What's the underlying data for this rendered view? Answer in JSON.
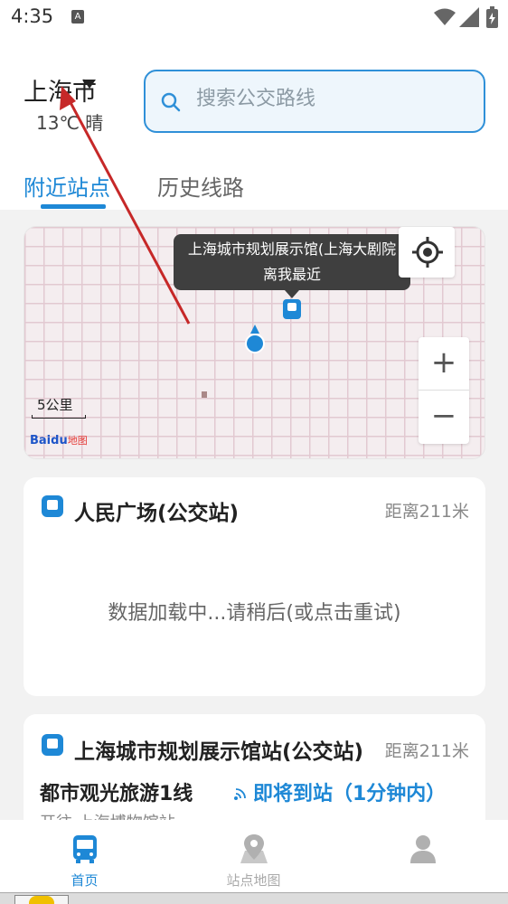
{
  "status_bar": {
    "time": "4:35",
    "notification_badge": "A"
  },
  "header": {
    "city": "上海市",
    "weather": "13℃ 晴",
    "search": {
      "placeholder": "搜索公交路线"
    }
  },
  "tabs": [
    {
      "label": "附近站点",
      "active": true
    },
    {
      "label": "历史线路",
      "active": false
    }
  ],
  "map": {
    "tooltip_line1": "上海城市规划展示馆(上海大剧院",
    "tooltip_line2": "离我最近",
    "scale": "5公里",
    "logo_bai": "Bai",
    "logo_du": "du",
    "logo_suffix": "地图",
    "zoom_in": "+",
    "zoom_out": "−"
  },
  "stops": [
    {
      "name": "人民广场(公交站)",
      "distance": "距离211米",
      "status": "数据加载中...请稍后(或点击重试)"
    },
    {
      "name": "上海城市规划展示馆站(公交站)",
      "distance": "距离211米",
      "route": "都市观光旅游1线",
      "arrival": "即将到站（1分钟内）",
      "toward": "开往 上海博物馆站"
    }
  ],
  "bottom_nav": [
    {
      "label": "首页",
      "icon": "bus-icon",
      "active": true
    },
    {
      "label": "站点地图",
      "icon": "map-pin-icon",
      "active": false
    },
    {
      "label": "",
      "icon": "person-icon",
      "active": false
    }
  ],
  "colors": {
    "accent": "#1e88d6",
    "tooltip": "#3f3f3f",
    "map_grid": "#e2c9d1"
  }
}
